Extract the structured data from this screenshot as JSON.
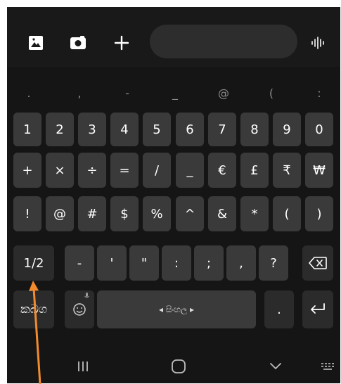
{
  "toolbar": {
    "icons": [
      "image-icon",
      "camera-icon",
      "add-icon",
      "voice-input-icon"
    ]
  },
  "symbol_strip": [
    ".",
    ",",
    "-",
    "_",
    "@",
    "(",
    ":"
  ],
  "rows": {
    "numbers": [
      "1",
      "2",
      "3",
      "4",
      "5",
      "6",
      "7",
      "8",
      "9",
      "0"
    ],
    "symbols1": [
      "+",
      "×",
      "÷",
      "=",
      "/",
      "_",
      "€",
      "£",
      "₹",
      "₩"
    ],
    "symbols2": [
      "!",
      "@",
      "#",
      "$",
      "%",
      "^",
      "&",
      "*",
      "(",
      ")"
    ],
    "symbols3": [
      "-",
      "'",
      "\"",
      ":",
      ";",
      ",",
      "?"
    ]
  },
  "keys": {
    "page_toggle": "1/2",
    "language_switch": "කඛග",
    "space_label": "◂ සිංහල ▸",
    "period": "."
  },
  "colors": {
    "background": "#151515",
    "key": "#3a3a3a",
    "dark_key": "#2b2b2b",
    "annotation_arrow": "#f28a2e"
  }
}
